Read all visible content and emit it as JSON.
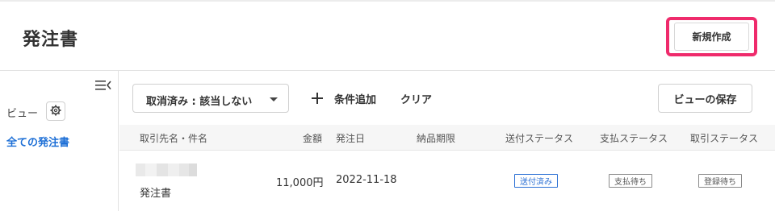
{
  "header": {
    "title": "発注書",
    "new_button_label": "新規作成"
  },
  "sidebar": {
    "view_label": "ビュー",
    "all_label": "全ての発注書"
  },
  "filters": {
    "selected_filter": "取消済み : 該当しない",
    "add_condition_label": "条件追加",
    "clear_label": "クリア",
    "save_view_label": "ビューの保存"
  },
  "table": {
    "columns": [
      "取引先名・件名",
      "金額",
      "発注日",
      "納品期限",
      "送付ステータス",
      "支払ステータス",
      "取引ステータス"
    ],
    "rows": [
      {
        "subject": "発注書",
        "amount": "11,000円",
        "order_date": "2022-11-18",
        "delivery_due": "",
        "send_status": "送付済み",
        "payment_status": "支払待ち",
        "trade_status": "登録待ち"
      }
    ]
  },
  "colors": {
    "accent_blue": "#1d6fd6",
    "highlight_pink": "#ef2b6c"
  }
}
